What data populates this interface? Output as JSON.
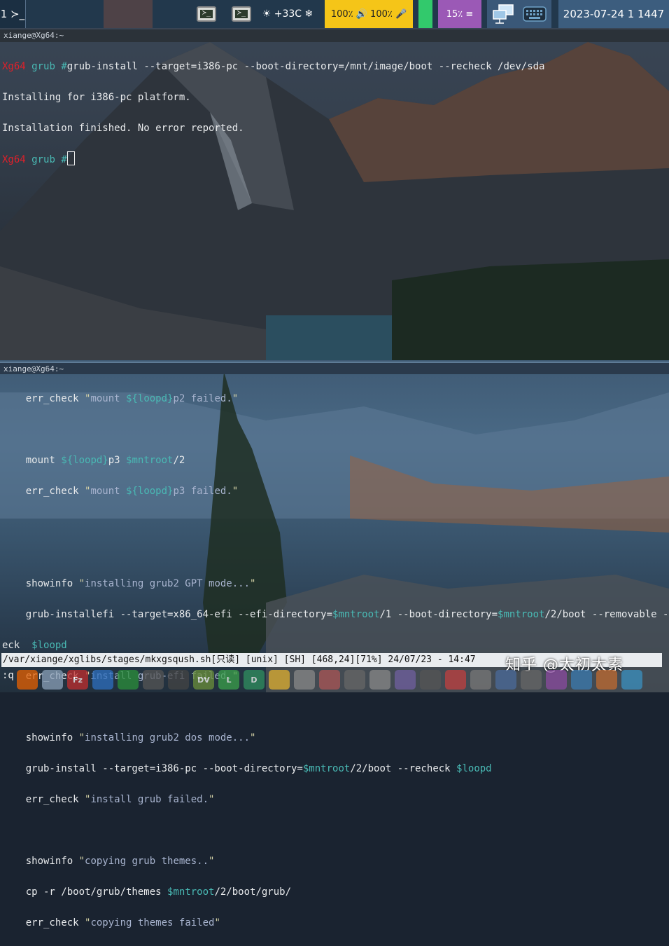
{
  "topbar": {
    "workspace": "1 ≻_",
    "weather": "☀ +33C ❄",
    "volume": "100٪ 🔊 100٪ 🎤",
    "cpu": "15٪ ≡",
    "datetime": "2023-07-24 1 1447",
    "icons": [
      "terminal-icon",
      "terminal-icon",
      "network-icon",
      "keyboard-icon"
    ],
    "colors": {
      "volume_bg": "#f5c518",
      "status_green": "#32c96c",
      "cpu_bg": "#9b59b6"
    }
  },
  "top_pane": {
    "title": "xiange@Xg64:~",
    "prompt_host": "Xg64",
    "prompt_dir": "grub",
    "prompt_sym": "#",
    "command": "grub-install --target=i386-pc --boot-directory=/mnt/image/boot --recheck /dev/sda",
    "output1": "Installing for i386-pc platform.",
    "output2": "Installation finished. No error reported."
  },
  "bottom_pane": {
    "title": "xiange@Xg64:~",
    "statusline": "/var/xiange/xglibs/stages/mkxgsqush.sh[只读] [unix] [SH] [468,24][71%] 24/07/23 - 14:47",
    "cmdline": ":q",
    "watermark": "知乎 @太初太素"
  },
  "dock": {
    "items": [
      {
        "label": "",
        "icon": "firefox-icon",
        "color": "#e66000"
      },
      {
        "label": "",
        "icon": "folder-icon",
        "color": "#8aa0b8"
      },
      {
        "label": "Fz",
        "icon": "filezilla-icon",
        "color": "#bf2d2d"
      },
      {
        "label": "",
        "icon": "app-icon",
        "color": "#2d6fbf"
      },
      {
        "label": "",
        "icon": "app-icon",
        "color": "#2a8f3a"
      },
      {
        "label": "",
        "icon": "app-icon",
        "color": "#555"
      },
      {
        "label": "",
        "icon": "app-icon",
        "color": "#444"
      },
      {
        "label": "DV",
        "icon": "app-icon",
        "color": "#6a8f3a"
      },
      {
        "label": "L",
        "icon": "app-icon",
        "color": "#3aa04a"
      },
      {
        "label": "D",
        "icon": "app-icon",
        "color": "#2f8f5f"
      },
      {
        "label": "",
        "icon": "app-icon",
        "color": "#e0b030"
      },
      {
        "label": "",
        "icon": "disc-icon",
        "color": "#888"
      },
      {
        "label": "",
        "icon": "app-icon",
        "color": "#aa5555"
      },
      {
        "label": "",
        "icon": "app-icon",
        "color": "#666"
      },
      {
        "label": "",
        "icon": "app-icon",
        "color": "#888"
      },
      {
        "label": "",
        "icon": "app-icon",
        "color": "#6f5fa0"
      },
      {
        "label": "",
        "icon": "app-icon",
        "color": "#555"
      },
      {
        "label": "",
        "icon": "app-icon",
        "color": "#c04040"
      },
      {
        "label": "",
        "icon": "app-icon",
        "color": "#777"
      },
      {
        "label": "",
        "icon": "app-icon",
        "color": "#4a6a9a"
      },
      {
        "label": "",
        "icon": "app-icon",
        "color": "#666"
      },
      {
        "label": "",
        "icon": "app-icon",
        "color": "#8a4aa0"
      },
      {
        "label": "",
        "icon": "app-icon",
        "color": "#3a7ab0"
      },
      {
        "label": "",
        "icon": "app-icon",
        "color": "#c06a30"
      },
      {
        "label": "",
        "icon": "app-icon",
        "color": "#3a90c0"
      }
    ]
  }
}
